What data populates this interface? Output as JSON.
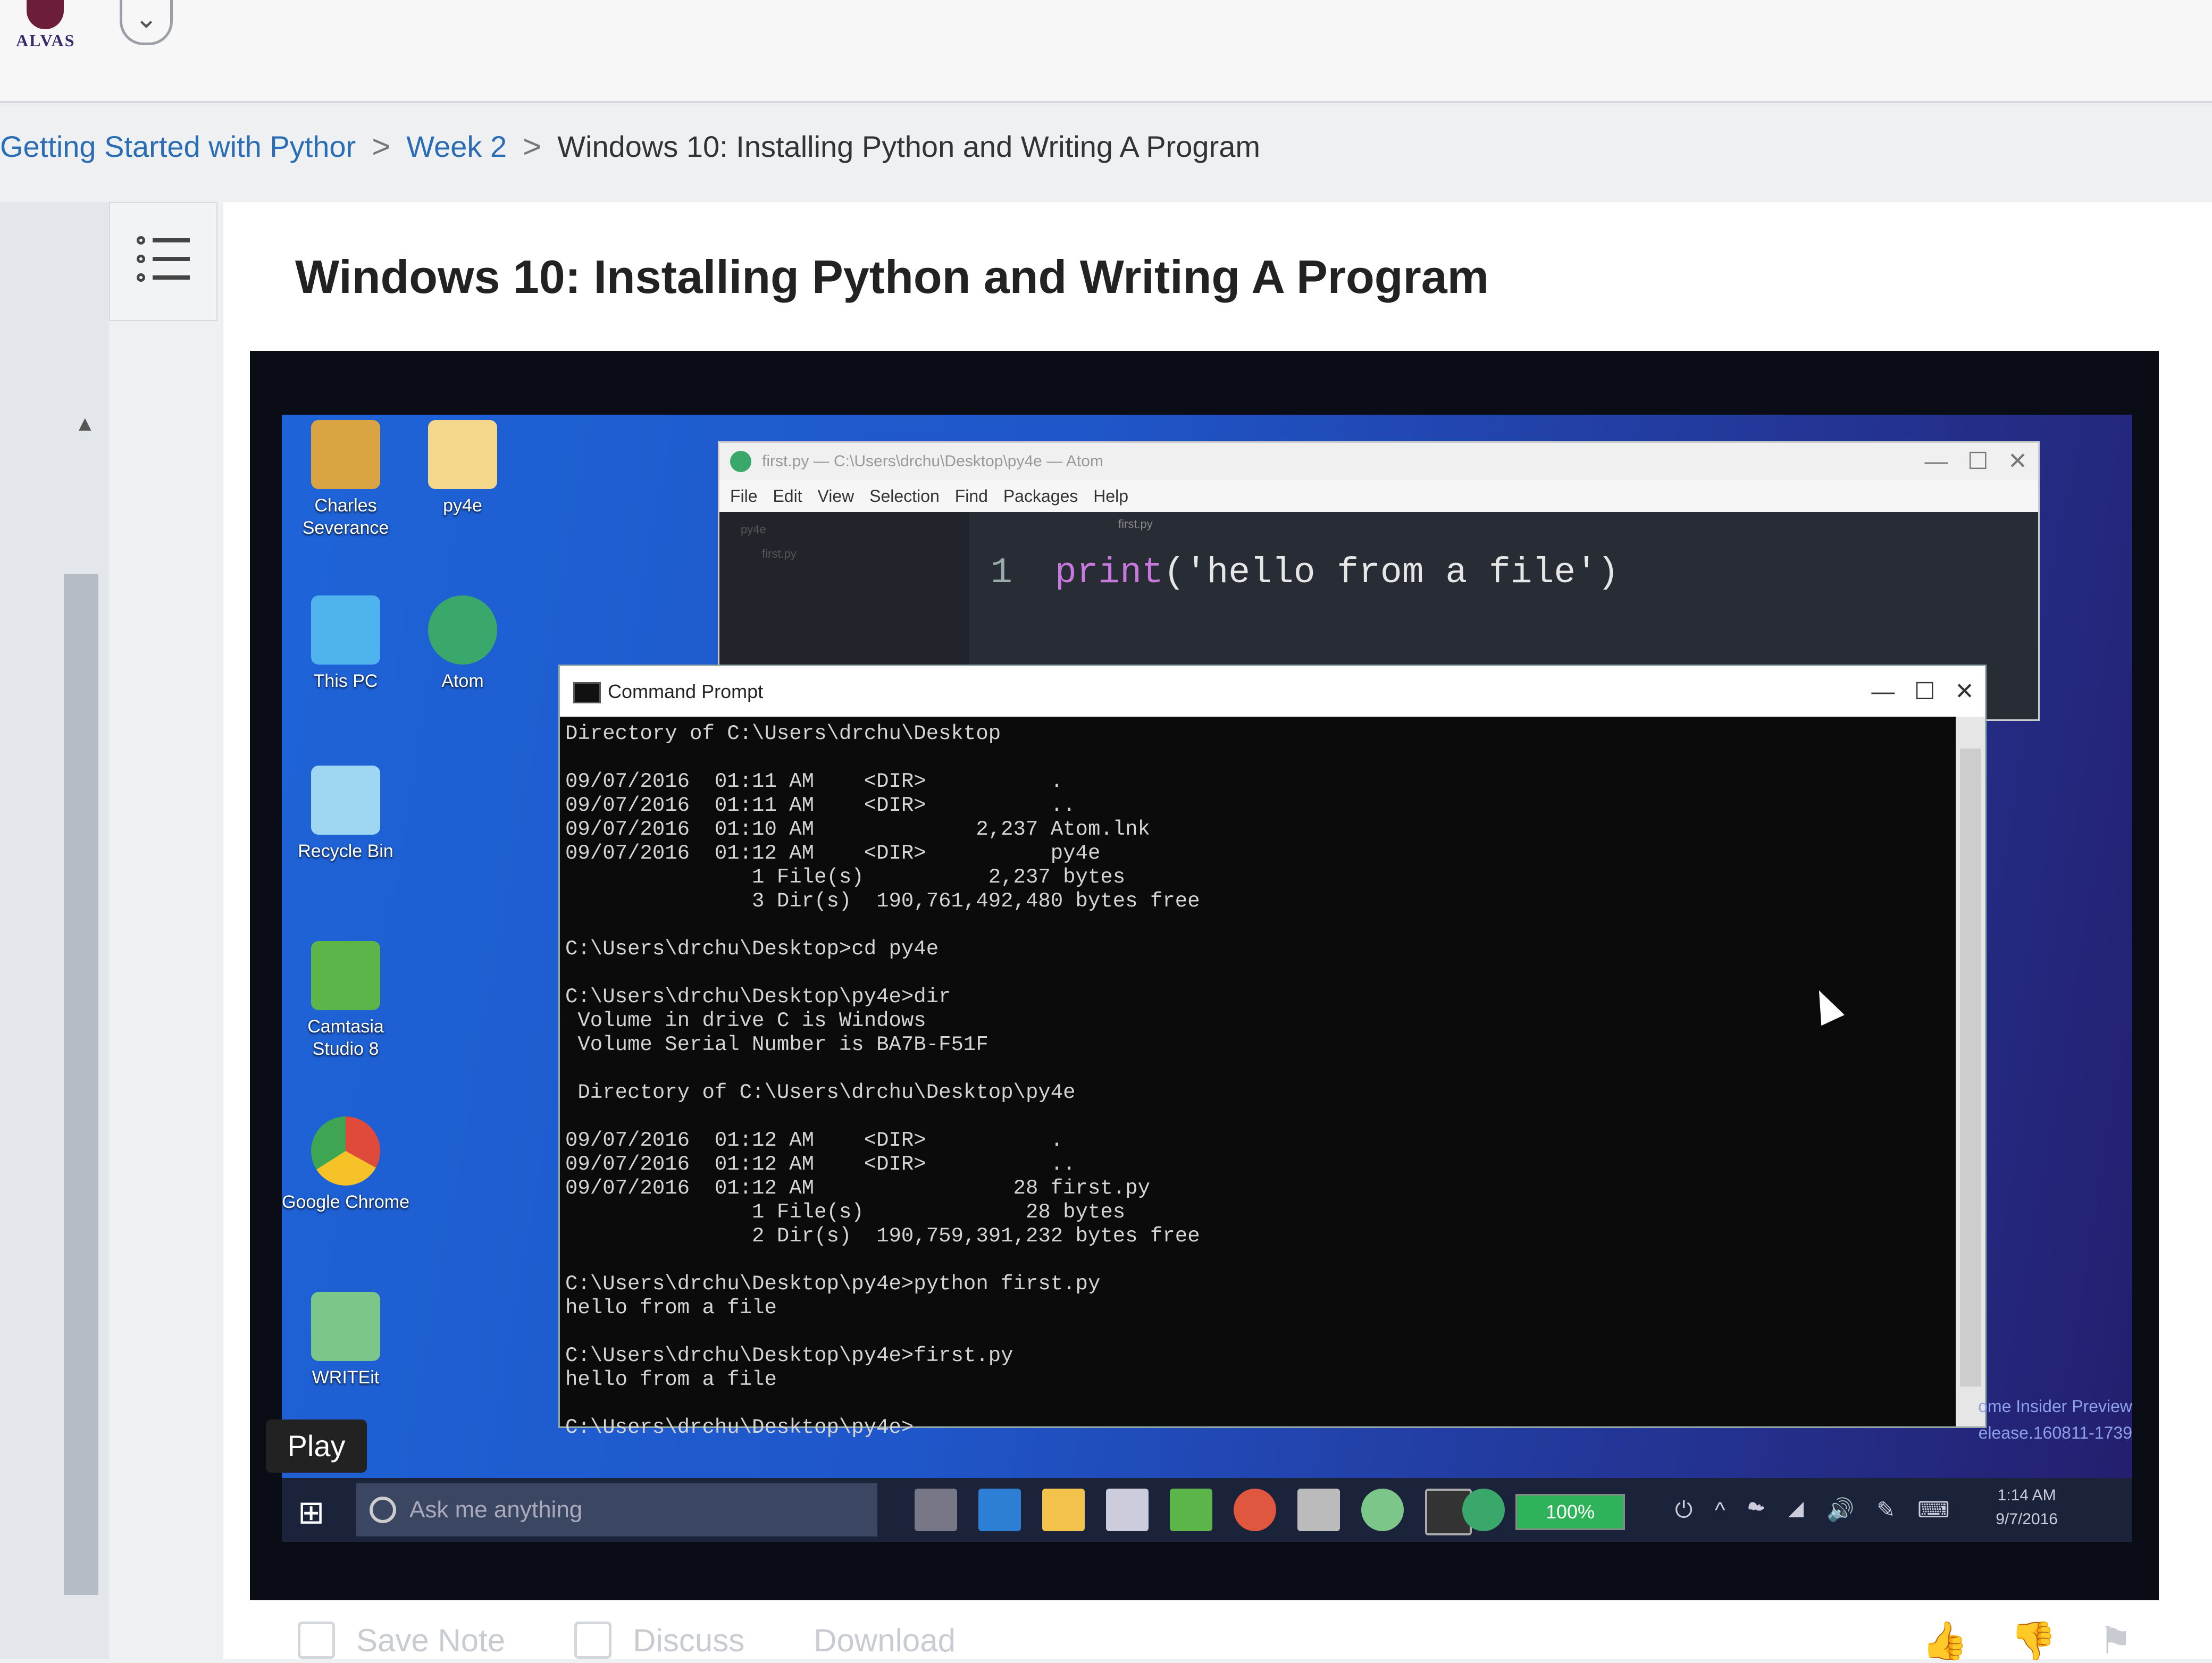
{
  "app": {
    "logo_text": "ALVAS"
  },
  "breadcrumb": {
    "items": [
      "Getting Started with Pythor",
      "Week 2",
      "Windows 10: Installing Python and Writing A Program"
    ],
    "separator": ">"
  },
  "page": {
    "title": "Windows 10: Installing Python and Writing A Program"
  },
  "video": {
    "play_label": "Play",
    "desktop_icons": [
      "Charles Severance",
      "py4e",
      "This PC",
      "Atom",
      "Recycle Bin",
      "Camtasia Studio 8",
      "Google Chrome",
      "WRITEit"
    ],
    "atom": {
      "title": "first.py — C:\\Users\\drchu\\Desktop\\py4e — Atom",
      "menu": "File Edit View Selection Find Packages Help",
      "tree_root": "py4e",
      "tree_file": "first.py",
      "tab": "first.py",
      "line_number": "1",
      "code_keyword": "print",
      "code_string": "('hello from a file')"
    },
    "cmd": {
      "title": "Command Prompt",
      "output": "Directory of C:\\Users\\drchu\\Desktop\n\n09/07/2016  01:11 AM    <DIR>          .\n09/07/2016  01:11 AM    <DIR>          ..\n09/07/2016  01:10 AM             2,237 Atom.lnk\n09/07/2016  01:12 AM    <DIR>          py4e\n               1 File(s)          2,237 bytes\n               3 Dir(s)  190,761,492,480 bytes free\n\nC:\\Users\\drchu\\Desktop>cd py4e\n\nC:\\Users\\drchu\\Desktop\\py4e>dir\n Volume in drive C is Windows\n Volume Serial Number is BA7B-F51F\n\n Directory of C:\\Users\\drchu\\Desktop\\py4e\n\n09/07/2016  01:12 AM    <DIR>          .\n09/07/2016  01:12 AM    <DIR>          ..\n09/07/2016  01:12 AM                28 first.py\n               1 File(s)             28 bytes\n               2 Dir(s)  190,759,391,232 bytes free\n\nC:\\Users\\drchu\\Desktop\\py4e>python first.py\nhello from a file\n\nC:\\Users\\drchu\\Desktop\\py4e>first.py\nhello from a file\n\nC:\\Users\\drchu\\Desktop\\py4e>"
    },
    "watermark": [
      "ome Insider Preview",
      "elease.160811-1739"
    ],
    "taskbar": {
      "search_placeholder": "Ask me anything",
      "battery": "100%",
      "time": "1:14 AM",
      "date": "9/7/2016"
    }
  },
  "actions": {
    "save_note": "Save Note",
    "discuss": "Discuss",
    "download": "Download"
  },
  "colors": {
    "link": "#2a6db5",
    "desktop": "#1f56c9",
    "terminal_bg": "#0b0b0b"
  }
}
